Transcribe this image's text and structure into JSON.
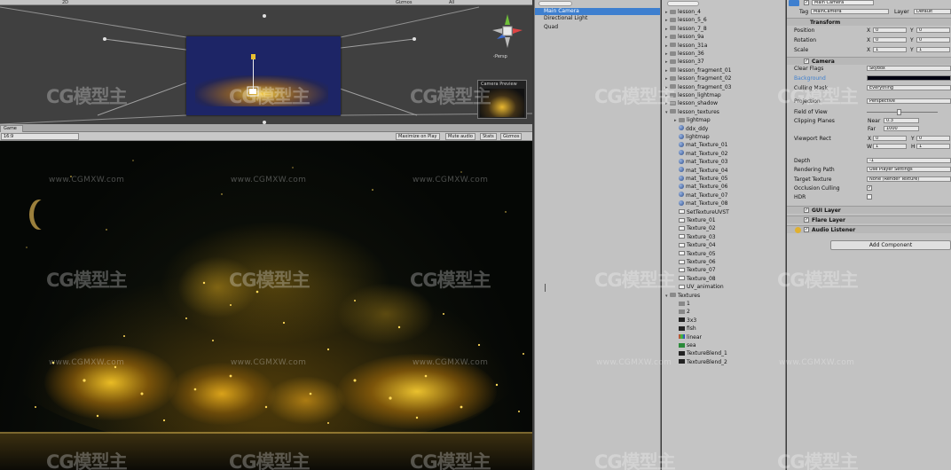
{
  "scene": {
    "toolbar": {
      "gizmos_label": "Gizmos",
      "zoom_label": "2D",
      "all_label": "All"
    },
    "persp_label": "‹Persp",
    "camera_preview_label": "Camera Preview"
  },
  "game": {
    "tab_label": "Game",
    "aspect_label": "16:9",
    "buttons": [
      "Maximize on Play",
      "Mute audio",
      "Stats",
      "Gizmos"
    ]
  },
  "hierarchy": {
    "items": [
      "Main Camera",
      "Directional Light",
      "Quad"
    ],
    "selected": "Main Camera"
  },
  "project": {
    "items": [
      {
        "label": "lesson_4",
        "icon": "folder",
        "indent": 0,
        "expanded": false
      },
      {
        "label": "lesson_5_6",
        "icon": "folder",
        "indent": 0,
        "expanded": false
      },
      {
        "label": "lesson_7_8",
        "icon": "folder",
        "indent": 0,
        "expanded": false
      },
      {
        "label": "lesson_9a",
        "icon": "folder",
        "indent": 0,
        "expanded": false
      },
      {
        "label": "lesson_31a",
        "icon": "folder",
        "indent": 0,
        "expanded": false
      },
      {
        "label": "lesson_36",
        "icon": "folder",
        "indent": 0,
        "expanded": false
      },
      {
        "label": "lesson_37",
        "icon": "folder",
        "indent": 0,
        "expanded": false
      },
      {
        "label": "lesson_fragment_01",
        "icon": "folder",
        "indent": 0,
        "expanded": false
      },
      {
        "label": "lesson_fragment_02",
        "icon": "folder",
        "indent": 0,
        "expanded": false
      },
      {
        "label": "lesson_fragment_03",
        "icon": "folder",
        "indent": 0,
        "expanded": false
      },
      {
        "label": "lesson_lightmap",
        "icon": "folder",
        "indent": 0,
        "expanded": false
      },
      {
        "label": "lesson_shadow",
        "icon": "folder",
        "indent": 0,
        "expanded": false
      },
      {
        "label": "lesson_textures",
        "icon": "folder",
        "indent": 0,
        "expanded": true
      },
      {
        "label": "lightmap",
        "icon": "folder",
        "indent": 1,
        "expanded": false
      },
      {
        "label": "ddx_ddy",
        "icon": "sphere",
        "indent": 1,
        "expanded": false
      },
      {
        "label": "lightmap",
        "icon": "sphere",
        "indent": 1,
        "expanded": false
      },
      {
        "label": "mat_Texture_01",
        "icon": "sphere",
        "indent": 1,
        "expanded": false
      },
      {
        "label": "mat_Texture_02",
        "icon": "sphere",
        "indent": 1,
        "expanded": false
      },
      {
        "label": "mat_Texture_03",
        "icon": "sphere",
        "indent": 1,
        "expanded": false
      },
      {
        "label": "mat_Texture_04",
        "icon": "sphere",
        "indent": 1,
        "expanded": false
      },
      {
        "label": "mat_Texture_05",
        "icon": "sphere",
        "indent": 1,
        "expanded": false
      },
      {
        "label": "mat_Texture_06",
        "icon": "sphere",
        "indent": 1,
        "expanded": false
      },
      {
        "label": "mat_Texture_07",
        "icon": "sphere",
        "indent": 1,
        "expanded": false
      },
      {
        "label": "mat_Texture_08",
        "icon": "sphere",
        "indent": 1,
        "expanded": false
      },
      {
        "label": "SetTextureUVST",
        "icon": "script",
        "indent": 1,
        "expanded": false
      },
      {
        "label": "Texture_01",
        "icon": "script",
        "indent": 1,
        "expanded": false
      },
      {
        "label": "Texture_02",
        "icon": "script",
        "indent": 1,
        "expanded": false
      },
      {
        "label": "Texture_03",
        "icon": "script",
        "indent": 1,
        "expanded": false
      },
      {
        "label": "Texture_04",
        "icon": "script",
        "indent": 1,
        "expanded": false
      },
      {
        "label": "Texture_05",
        "icon": "script",
        "indent": 1,
        "expanded": false
      },
      {
        "label": "Texture_06",
        "icon": "script",
        "indent": 1,
        "expanded": false
      },
      {
        "label": "Texture_07",
        "icon": "script",
        "indent": 1,
        "expanded": false
      },
      {
        "label": "Texture_08",
        "icon": "script",
        "indent": 1,
        "expanded": false
      },
      {
        "label": "UV_animation",
        "icon": "script",
        "indent": 1,
        "expanded": false
      },
      {
        "label": "Textures",
        "icon": "folder",
        "indent": 0,
        "expanded": true
      },
      {
        "label": "1",
        "icon": "tex-gray",
        "indent": 1,
        "expanded": false
      },
      {
        "label": "2",
        "icon": "tex-gray",
        "indent": 1,
        "expanded": false
      },
      {
        "label": "3x3",
        "icon": "tex-dark",
        "indent": 1,
        "expanded": false
      },
      {
        "label": "fish",
        "icon": "tex-dark",
        "indent": 1,
        "expanded": false
      },
      {
        "label": "linear",
        "icon": "tex-color",
        "indent": 1,
        "expanded": false
      },
      {
        "label": "sea",
        "icon": "tex-green",
        "indent": 1,
        "expanded": false
      },
      {
        "label": "TextureBlend_1",
        "icon": "tex-dark",
        "indent": 1,
        "expanded": false
      },
      {
        "label": "TextureBlend_2",
        "icon": "tex-dark",
        "indent": 1,
        "expanded": false
      }
    ]
  },
  "inspector": {
    "object_name": "Main Camera",
    "tag_label": "Tag",
    "tag_value": "MainCamera",
    "layer_label": "Layer",
    "layer_value": "Default",
    "transform": {
      "header": "Transform",
      "rows": [
        {
          "label": "Position",
          "x": "0",
          "y": "0"
        },
        {
          "label": "Rotation",
          "x": "0",
          "y": "0"
        },
        {
          "label": "Scale",
          "x": "1",
          "y": "1"
        }
      ]
    },
    "camera": {
      "header": "Camera",
      "clear_flags_label": "Clear Flags",
      "clear_flags": "Skybox",
      "background_label": "Background",
      "culling_mask_label": "Culling Mask",
      "culling_mask": "Everything",
      "projection_label": "Projection",
      "projection": "Perspective",
      "fov_label": "Field of View",
      "clipping_label": "Clipping Planes",
      "near_label": "Near",
      "near": "0.3",
      "far_label": "Far",
      "far": "1000",
      "viewport_label": "Viewport Rect",
      "vx": "0",
      "vy": "0",
      "vw": "1",
      "vh": "1",
      "x_label": "X",
      "y_label": "Y",
      "w_label": "W",
      "h_label": "H",
      "depth_label": "Depth",
      "depth": "-1",
      "rendering_path_label": "Rendering Path",
      "rendering_path": "Use Player Settings",
      "target_texture_label": "Target Texture",
      "target_texture": "None (Render Texture)",
      "occlusion_label": "Occlusion Culling",
      "hdr_label": "HDR"
    },
    "components": [
      "GUI Layer",
      "Flare Layer",
      "Audio Listener"
    ],
    "add_component": "Add Component",
    "background_color": "#000010",
    "accent": "#3e7fcf"
  },
  "watermark": {
    "brand": "CG模型主",
    "url": "www.CGMXW.com"
  }
}
